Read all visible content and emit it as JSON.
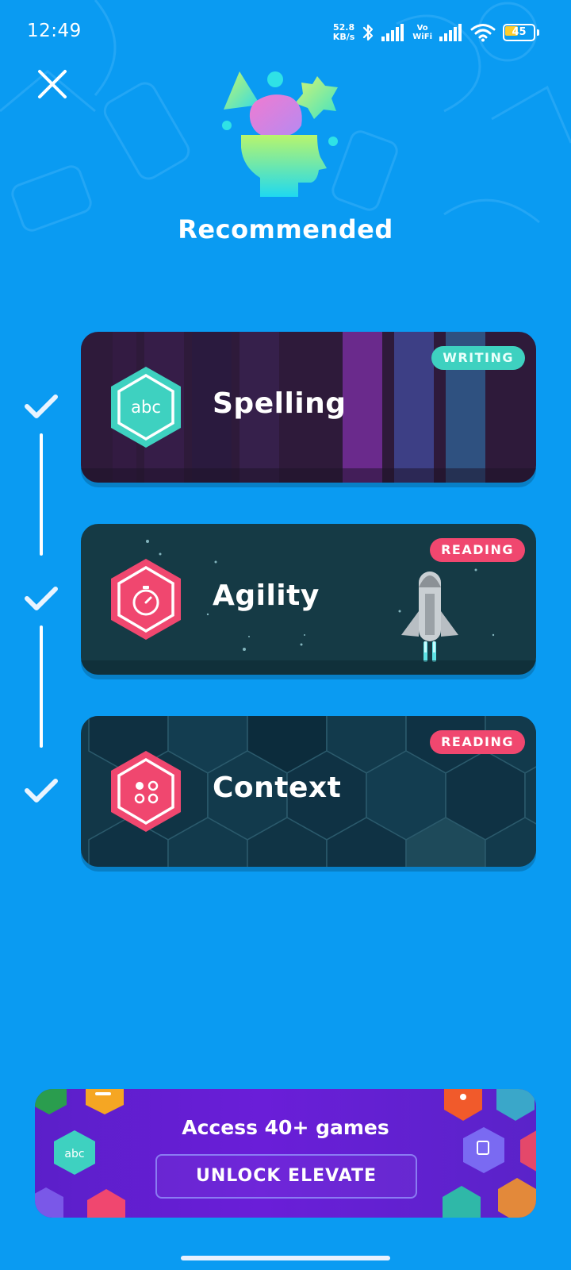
{
  "status_bar": {
    "time": "12:49",
    "net_speed_value": "52.8",
    "net_speed_unit": "KB/s",
    "vo_label": "Vo",
    "wifi_label": "WiFi",
    "battery_level": "45",
    "battery_fraction": 0.45
  },
  "header": {
    "close_icon": "close-icon",
    "hero_icon": "brain-head-icon",
    "title": "Recommended"
  },
  "progress": {
    "checks": [
      "check-icon",
      "check-icon",
      "check-icon"
    ]
  },
  "cards": [
    {
      "title": "Spelling",
      "badge": "WRITING",
      "icon_text": "abc",
      "icon": "abc-icon",
      "accent": "#3ed1c0",
      "badge_text_color": "#e9fffb"
    },
    {
      "title": "Agility",
      "badge": "READING",
      "icon": "stopwatch-icon",
      "accent": "#f0476f",
      "badge_text_color": "#ffffff"
    },
    {
      "title": "Context",
      "badge": "READING",
      "icon": "four-dots-icon",
      "accent": "#f0476f",
      "badge_text_color": "#ffffff"
    }
  ],
  "banner": {
    "title": "Access 40+ games",
    "button_label": "UNLOCK ELEVATE",
    "abc_label": "abc"
  },
  "colors": {
    "background": "#0a9bf2",
    "writing_badge": "#3ed1c0",
    "reading_badge": "#f0476f",
    "banner_purple": "#6a1ed8"
  }
}
